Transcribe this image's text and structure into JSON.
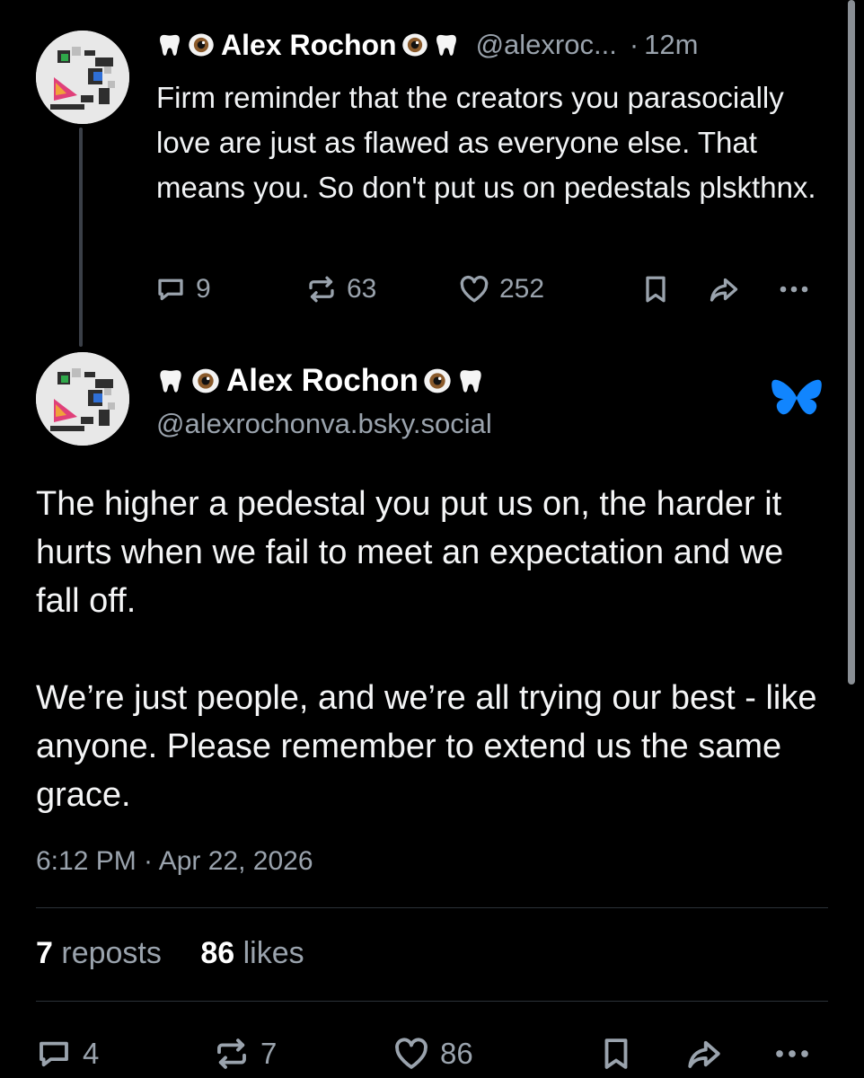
{
  "parent_post": {
    "display_name": "Alex Rochon",
    "emoji_prefix": [
      "tooth",
      "eye"
    ],
    "emoji_suffix": [
      "eye",
      "tooth"
    ],
    "handle": "@alexroc...",
    "separator": "·",
    "age": "12m",
    "text": "Firm reminder that the creators you parasocially love are just as flawed as everyone else. That means you. So don't put us on pedestals plskthnx.",
    "counts": {
      "replies": "9",
      "reposts": "63",
      "likes": "252"
    }
  },
  "main_post": {
    "display_name": "Alex Rochon",
    "handle": "@alexrochonva.bsky.social",
    "paragraphs": [
      "The higher a pedestal you put us on, the harder it hurts when we fail to meet an expectation and we fall off.",
      "We’re just people, and we’re all trying our best - like anyone. Please remember to extend us the same grace."
    ],
    "timestamp": "6:12 PM · Apr 22, 2026",
    "stats": {
      "reposts_count": "7",
      "reposts_label": "reposts",
      "likes_count": "86",
      "likes_label": "likes"
    },
    "counts": {
      "replies": "4",
      "reposts": "7",
      "likes": "86"
    }
  },
  "icons": {
    "reply": "reply-icon",
    "repost": "repost-icon",
    "like": "heart-icon",
    "bookmark": "bookmark-icon",
    "share": "share-icon",
    "more": "more-icon",
    "platform": "butterfly-icon"
  },
  "colors": {
    "background": "#000000",
    "muted": "#9aa3ad",
    "accent": "#1185fe"
  }
}
